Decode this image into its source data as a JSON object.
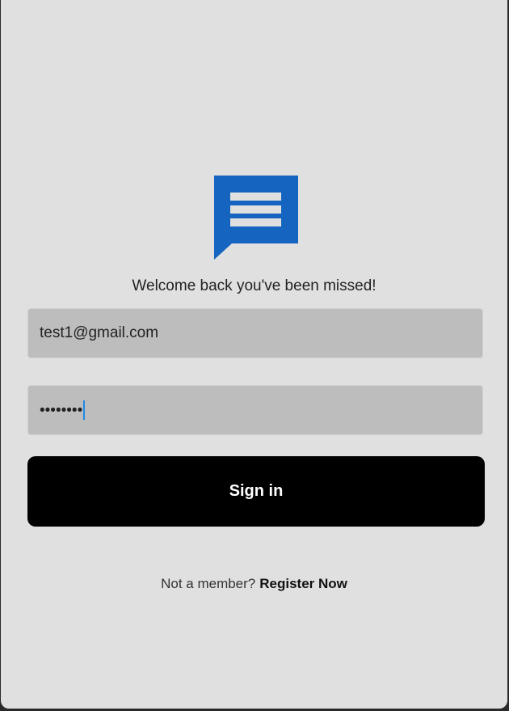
{
  "colors": {
    "background": "#e0e0e0",
    "logo": "#1565c0",
    "field": "#bdbdbd",
    "button": "#000000",
    "caret": "#1e88e5"
  },
  "logo": {
    "icon": "chat-message-icon"
  },
  "welcome_text": "Welcome back you've been missed!",
  "email_field": {
    "value": "test1@gmail.com"
  },
  "password_field": {
    "masked_value": "••••••••"
  },
  "sign_in_button": {
    "label": "Sign in"
  },
  "register": {
    "prompt": "Not a member?",
    "link_label": "Register Now"
  }
}
